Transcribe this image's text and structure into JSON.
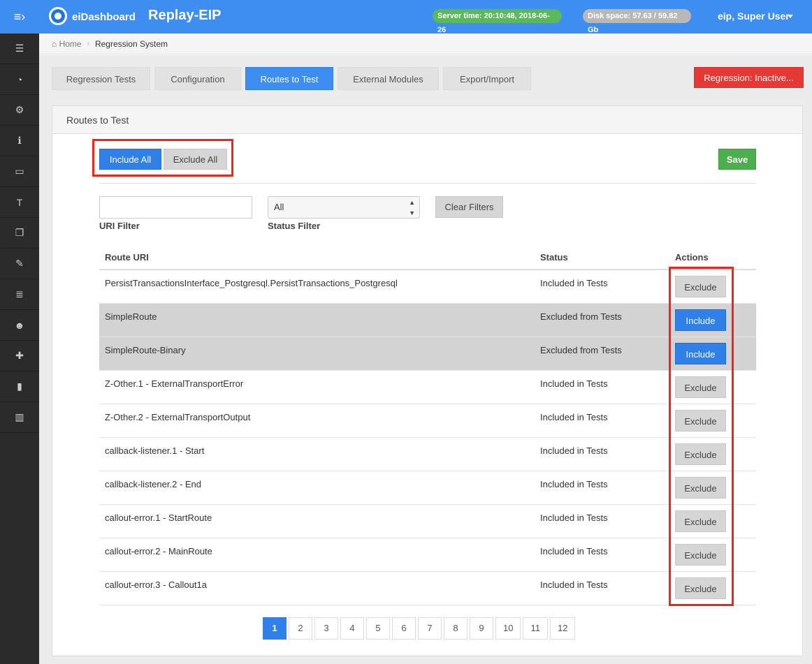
{
  "sidebar": {
    "toggle_icon": "menu-toggle-icon",
    "items": [
      {
        "icon": "server-icon",
        "glyph": "☰"
      },
      {
        "icon": "dashboard-icon",
        "glyph": "◔"
      },
      {
        "icon": "cogs-icon",
        "glyph": "⚙"
      },
      {
        "icon": "info-icon",
        "glyph": "ℹ"
      },
      {
        "icon": "monitor-icon",
        "glyph": "▭"
      },
      {
        "icon": "text-icon",
        "glyph": "T"
      },
      {
        "icon": "copy-icon",
        "glyph": "❐"
      },
      {
        "icon": "edit-icon",
        "glyph": "✎"
      },
      {
        "icon": "list-icon",
        "glyph": "≣"
      },
      {
        "icon": "users-icon",
        "glyph": "☻"
      },
      {
        "icon": "puzzle-icon",
        "glyph": "✚"
      },
      {
        "icon": "file-icon",
        "glyph": "▮"
      },
      {
        "icon": "bar-chart-icon",
        "glyph": "▥"
      }
    ]
  },
  "header": {
    "brand": "eiDashboard",
    "title": "Replay-EIP",
    "server_time": "Server time: 20:10:48, 2018-06-26",
    "disk_space": "Disk space: 57.63 / 59.82 Gb",
    "user": "eip, Super User"
  },
  "breadcrumb": {
    "home": "Home",
    "current": "Regression System"
  },
  "tabs": [
    {
      "label": "Regression Tests",
      "active": false
    },
    {
      "label": "Configuration",
      "active": false
    },
    {
      "label": "Routes to Test",
      "active": true
    },
    {
      "label": "External Modules",
      "active": false
    },
    {
      "label": "Export/Import",
      "active": false
    }
  ],
  "regression_status": "Regression: Inactive...",
  "panel": {
    "title": "Routes to Test",
    "include_all": "Include All",
    "exclude_all": "Exclude All",
    "save": "Save"
  },
  "filters": {
    "uri_value": "",
    "uri_label": "URI Filter",
    "status_value": "All",
    "status_label": "Status Filter",
    "clear": "Clear Filters"
  },
  "table": {
    "columns": [
      "Route URI",
      "Status",
      "Actions"
    ],
    "rows": [
      {
        "uri": "PersistTransactionsInterface_Postgresql.PersistTransactions_Postgresql",
        "status": "Included in Tests",
        "action": "Exclude"
      },
      {
        "uri": "SimpleRoute",
        "status": "Excluded from Tests",
        "action": "Include"
      },
      {
        "uri": "SimpleRoute-Binary",
        "status": "Excluded from Tests",
        "action": "Include"
      },
      {
        "uri": "Z-Other.1 - ExternalTransportError",
        "status": "Included in Tests",
        "action": "Exclude"
      },
      {
        "uri": "Z-Other.2 - ExternalTransportOutput",
        "status": "Included in Tests",
        "action": "Exclude"
      },
      {
        "uri": "callback-listener.1 - Start",
        "status": "Included in Tests",
        "action": "Exclude"
      },
      {
        "uri": "callback-listener.2 - End",
        "status": "Included in Tests",
        "action": "Exclude"
      },
      {
        "uri": "callout-error.1 - StartRoute",
        "status": "Included in Tests",
        "action": "Exclude"
      },
      {
        "uri": "callout-error.2 - MainRoute",
        "status": "Included in Tests",
        "action": "Exclude"
      },
      {
        "uri": "callout-error.3 - Callout1a",
        "status": "Included in Tests",
        "action": "Exclude"
      }
    ]
  },
  "pagination": {
    "pages": [
      "1",
      "2",
      "3",
      "4",
      "5",
      "6",
      "7",
      "8",
      "9",
      "10",
      "11",
      "12"
    ],
    "active": "1"
  },
  "colors": {
    "accent": "#3d8ef0",
    "danger": "#e53935",
    "success": "#4cae4c",
    "highlight": "#f0261b"
  }
}
